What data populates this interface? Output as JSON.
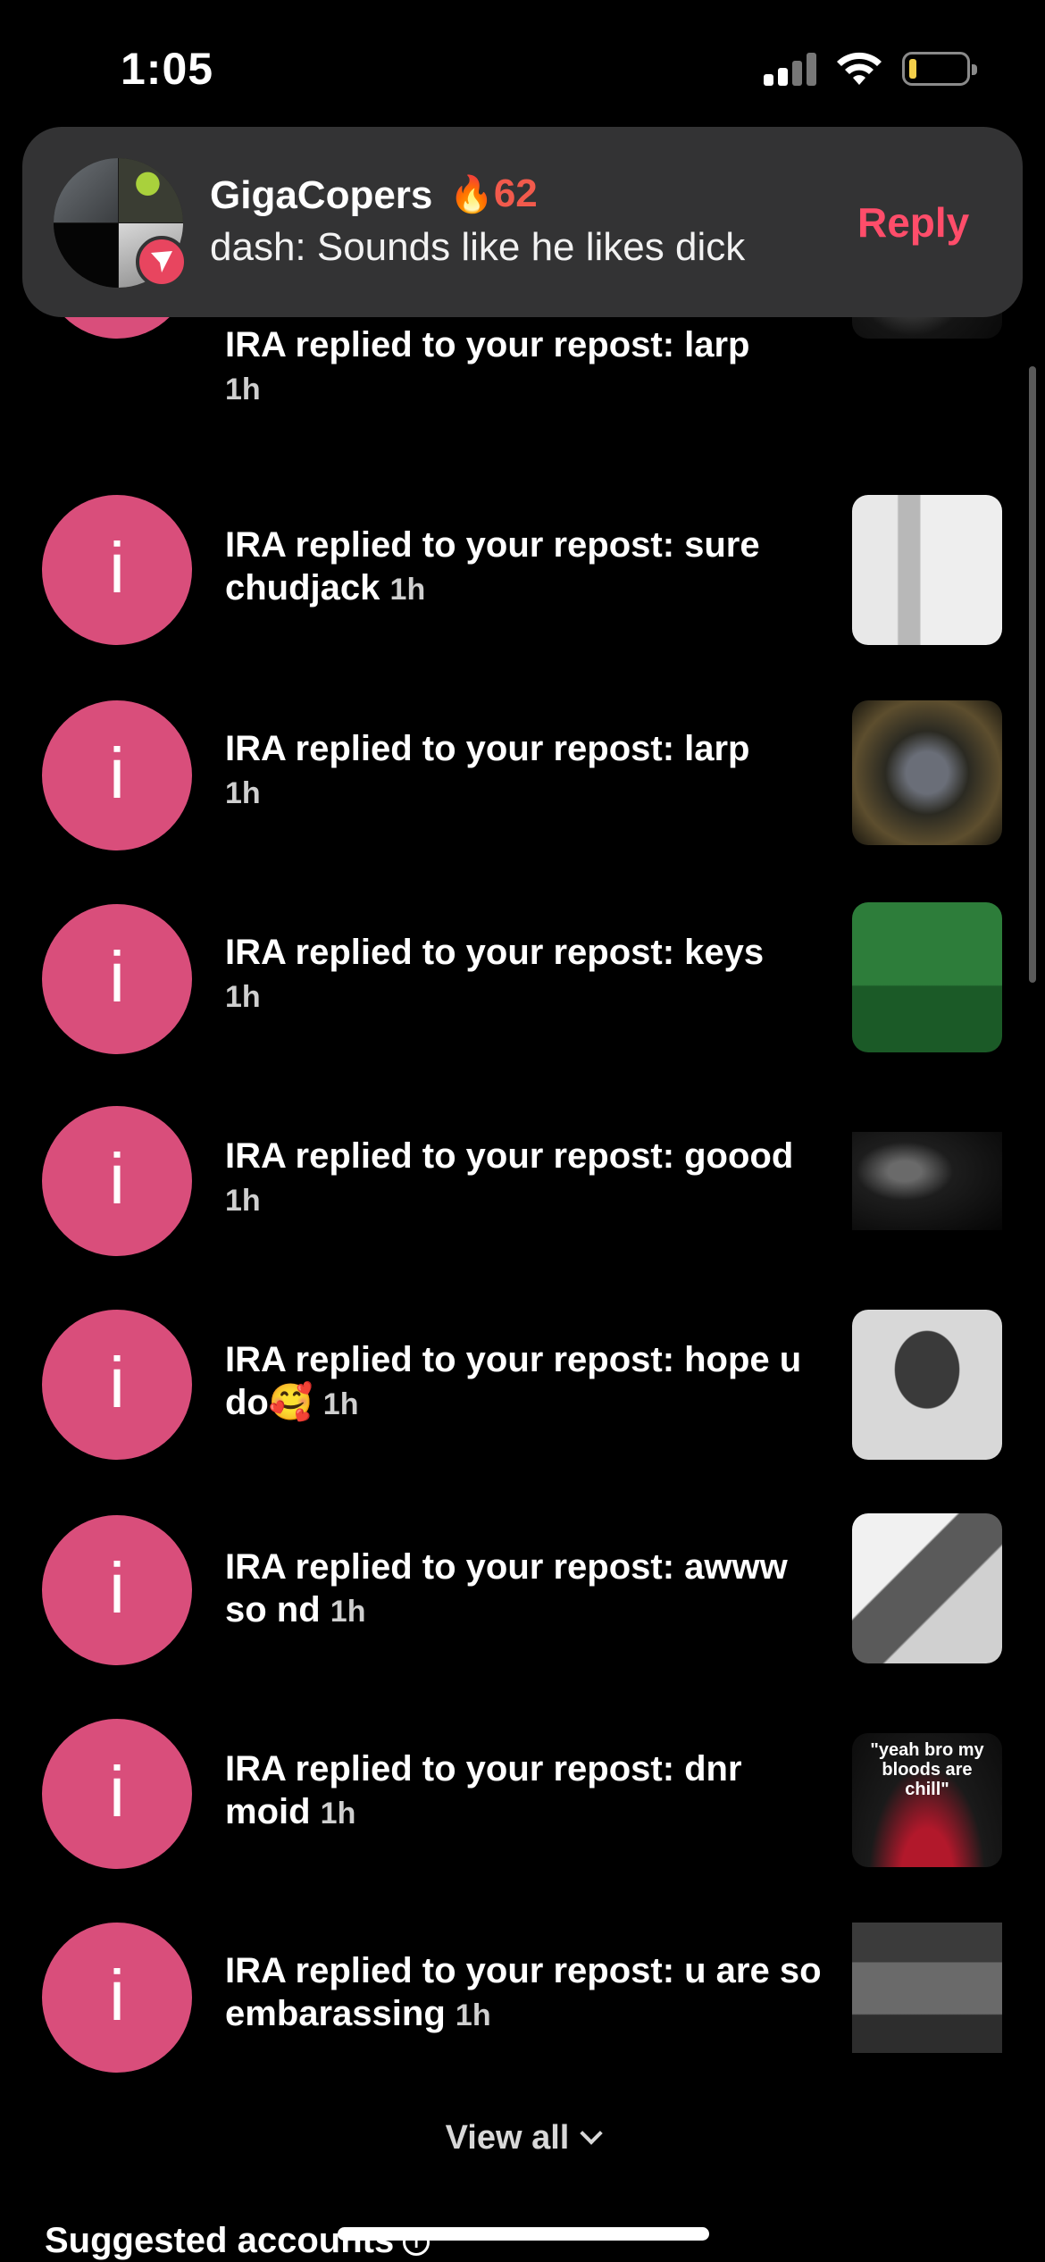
{
  "status_bar": {
    "time": "1:05"
  },
  "banner": {
    "name": "GigaCopers",
    "streak_icon": "🔥",
    "streak_count": "62",
    "message": "dash: Sounds like he likes dick",
    "reply_label": "Reply"
  },
  "notifications": [
    {
      "text": "IRA replied to your repost: larp",
      "time": "1h"
    },
    {
      "text": "IRA replied to your repost: sure chudjack",
      "time": "1h"
    },
    {
      "text": "IRA replied to your repost: larp",
      "time": "1h"
    },
    {
      "text": "IRA replied to your repost: keys",
      "time": "1h"
    },
    {
      "text": "IRA replied to your repost: goood",
      "time": "1h"
    },
    {
      "text": "IRA replied to your repost: hope u do🥰",
      "time": "1h"
    },
    {
      "text": "IRA replied to your repost: awww so nd",
      "time": "1h"
    },
    {
      "text": "IRA replied to your repost: dnr moid",
      "time": "1h"
    },
    {
      "text": "IRA replied to your repost: u are so embarassing",
      "time": "1h"
    }
  ],
  "thumb_captions": {
    "thumb8": "\"yeah bro my bloods are chill\""
  },
  "avatar_glyph": "i",
  "view_all_label": "View all",
  "suggested_label": "Suggested accounts",
  "info_glyph": "i",
  "colors": {
    "avatar_pink": "#d94e7b",
    "reply_red": "#ff4d6a",
    "streak_orange": "#f25a4c",
    "banner_bg": "#333334"
  }
}
